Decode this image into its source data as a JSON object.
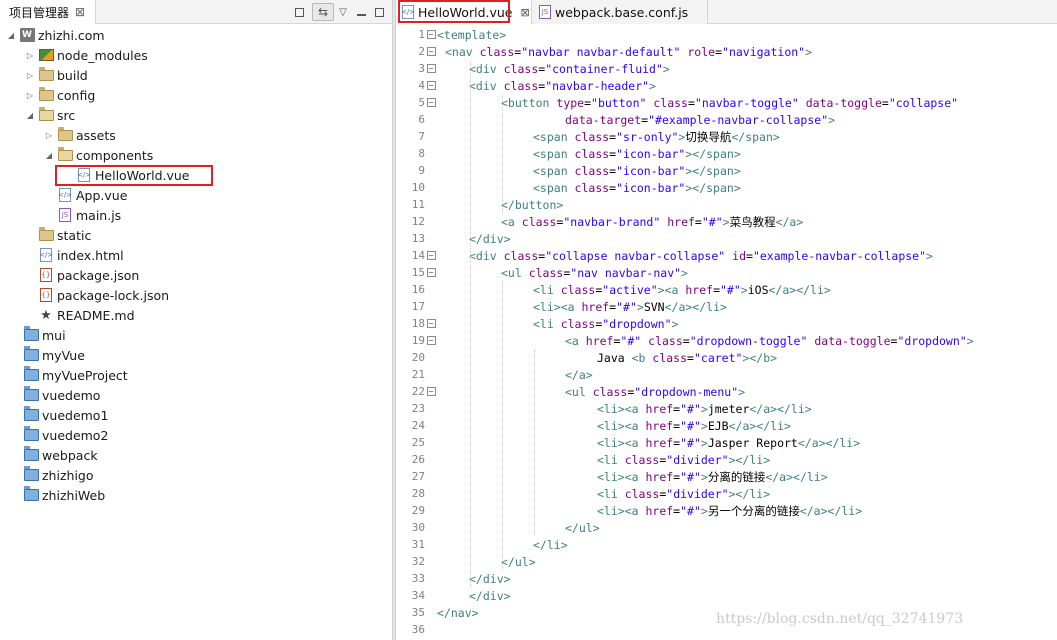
{
  "left_panel": {
    "tab_title": "项目管理器",
    "tab_close": "⊠",
    "toolbar": {
      "link_icon": "⇆",
      "menu_icon": "▽"
    },
    "tree": [
      {
        "label": "zhizhi.com",
        "icon": "web-project-icon",
        "toggle": "◢"
      },
      {
        "label": "node_modules",
        "icon": "node-modules-icon",
        "toggle": "▷"
      },
      {
        "label": "build",
        "icon": "folder-icon",
        "toggle": "▷"
      },
      {
        "label": "config",
        "icon": "folder-icon",
        "toggle": "▷"
      },
      {
        "label": "src",
        "icon": "folder-open-icon",
        "toggle": "◢"
      },
      {
        "label": "assets",
        "icon": "folder-icon",
        "toggle": "▷"
      },
      {
        "label": "components",
        "icon": "folder-open-icon",
        "toggle": "◢"
      },
      {
        "label": "HelloWorld.vue",
        "icon": "vue-file-icon",
        "toggle": ""
      },
      {
        "label": "App.vue",
        "icon": "vue-file-icon",
        "toggle": ""
      },
      {
        "label": "main.js",
        "icon": "js-file-icon",
        "toggle": ""
      },
      {
        "label": "static",
        "icon": "folder-icon",
        "toggle": ""
      },
      {
        "label": "index.html",
        "icon": "html-file-icon",
        "toggle": ""
      },
      {
        "label": "package.json",
        "icon": "json-file-icon",
        "toggle": ""
      },
      {
        "label": "package-lock.json",
        "icon": "json-file-icon",
        "toggle": ""
      },
      {
        "label": "README.md",
        "icon": "star-icon",
        "toggle": ""
      },
      {
        "label": "mui",
        "icon": "project-icon",
        "toggle": ""
      },
      {
        "label": "myVue",
        "icon": "project-icon",
        "toggle": ""
      },
      {
        "label": "myVueProject",
        "icon": "project-icon",
        "toggle": ""
      },
      {
        "label": "vuedemo",
        "icon": "project-icon",
        "toggle": ""
      },
      {
        "label": "vuedemo1",
        "icon": "project-icon",
        "toggle": ""
      },
      {
        "label": "vuedemo2",
        "icon": "project-icon",
        "toggle": ""
      },
      {
        "label": "webpack",
        "icon": "project-icon",
        "toggle": ""
      },
      {
        "label": "zhizhigo",
        "icon": "project-icon",
        "toggle": ""
      },
      {
        "label": "zhizhiWeb",
        "icon": "project-icon",
        "toggle": ""
      }
    ]
  },
  "editor": {
    "tabs": [
      {
        "label": "HelloWorld.vue",
        "close": "⊠"
      },
      {
        "label": "webpack.base.conf.js"
      }
    ],
    "watermark": "https://blog.csdn.net/qq_32741973",
    "lines": [
      {
        "n": "1",
        "fold": "−",
        "indent": 0,
        "parts": [
          [
            "tag",
            "<template>"
          ]
        ]
      },
      {
        "n": "2",
        "fold": "−",
        "indent": 1,
        "parts": [
          [
            "tag",
            "<nav "
          ],
          [
            "attr",
            "class"
          ],
          [
            "txt",
            "="
          ],
          [
            "val",
            "\"navbar navbar-default\""
          ],
          [
            "txt",
            " "
          ],
          [
            "attr",
            "role"
          ],
          [
            "txt",
            "="
          ],
          [
            "val",
            "\"navigation\""
          ],
          [
            "tag",
            ">"
          ]
        ]
      },
      {
        "n": "3",
        "fold": "−",
        "indent": 2,
        "parts": [
          [
            "tag",
            "<div "
          ],
          [
            "attr",
            "class"
          ],
          [
            "txt",
            "="
          ],
          [
            "val",
            "\"container-fluid\""
          ],
          [
            "tag",
            ">"
          ]
        ]
      },
      {
        "n": "4",
        "fold": "−",
        "indent": 2,
        "parts": [
          [
            "tag",
            "<div "
          ],
          [
            "attr",
            "class"
          ],
          [
            "txt",
            "="
          ],
          [
            "val",
            "\"navbar-header\""
          ],
          [
            "tag",
            ">"
          ]
        ]
      },
      {
        "n": "5",
        "fold": "−",
        "indent": 3,
        "parts": [
          [
            "tag",
            "<button "
          ],
          [
            "attr",
            "type"
          ],
          [
            "txt",
            "="
          ],
          [
            "val",
            "\"button\""
          ],
          [
            "txt",
            " "
          ],
          [
            "attr",
            "class"
          ],
          [
            "txt",
            "="
          ],
          [
            "val",
            "\"navbar-toggle\""
          ],
          [
            "txt",
            " "
          ],
          [
            "attr",
            "data-toggle"
          ],
          [
            "txt",
            "="
          ],
          [
            "val",
            "\"collapse\""
          ]
        ]
      },
      {
        "n": "6",
        "fold": "",
        "indent": 5,
        "parts": [
          [
            "attr",
            "data-target"
          ],
          [
            "txt",
            "="
          ],
          [
            "val",
            "\"#example-navbar-collapse\""
          ],
          [
            "tag",
            ">"
          ]
        ]
      },
      {
        "n": "7",
        "fold": "",
        "indent": 4,
        "parts": [
          [
            "tag",
            "<span "
          ],
          [
            "attr",
            "class"
          ],
          [
            "txt",
            "="
          ],
          [
            "val",
            "\"sr-only\""
          ],
          [
            "tag",
            ">"
          ],
          [
            "txt",
            "切换导航"
          ],
          [
            "tag",
            "</span>"
          ]
        ]
      },
      {
        "n": "8",
        "fold": "",
        "indent": 4,
        "parts": [
          [
            "tag",
            "<span "
          ],
          [
            "attr",
            "class"
          ],
          [
            "txt",
            "="
          ],
          [
            "val",
            "\"icon-bar\""
          ],
          [
            "tag",
            "></span>"
          ]
        ]
      },
      {
        "n": "9",
        "fold": "",
        "indent": 4,
        "parts": [
          [
            "tag",
            "<span "
          ],
          [
            "attr",
            "class"
          ],
          [
            "txt",
            "="
          ],
          [
            "val",
            "\"icon-bar\""
          ],
          [
            "tag",
            "></span>"
          ]
        ]
      },
      {
        "n": "10",
        "fold": "",
        "indent": 4,
        "parts": [
          [
            "tag",
            "<span "
          ],
          [
            "attr",
            "class"
          ],
          [
            "txt",
            "="
          ],
          [
            "val",
            "\"icon-bar\""
          ],
          [
            "tag",
            "></span>"
          ]
        ]
      },
      {
        "n": "11",
        "fold": "",
        "indent": 3,
        "parts": [
          [
            "tag",
            "</button>"
          ]
        ]
      },
      {
        "n": "12",
        "fold": "",
        "indent": 3,
        "parts": [
          [
            "tag",
            "<a "
          ],
          [
            "attr",
            "class"
          ],
          [
            "txt",
            "="
          ],
          [
            "val",
            "\"navbar-brand\""
          ],
          [
            "txt",
            " "
          ],
          [
            "attr",
            "href"
          ],
          [
            "txt",
            "="
          ],
          [
            "val",
            "\"#\""
          ],
          [
            "tag",
            ">"
          ],
          [
            "txt",
            "菜鸟教程"
          ],
          [
            "tag",
            "</a>"
          ]
        ]
      },
      {
        "n": "13",
        "fold": "",
        "indent": 2,
        "parts": [
          [
            "tag",
            "</div>"
          ]
        ]
      },
      {
        "n": "14",
        "fold": "−",
        "indent": 2,
        "parts": [
          [
            "tag",
            "<div "
          ],
          [
            "attr",
            "class"
          ],
          [
            "txt",
            "="
          ],
          [
            "val",
            "\"collapse navbar-collapse\""
          ],
          [
            "txt",
            " "
          ],
          [
            "attr",
            "id"
          ],
          [
            "txt",
            "="
          ],
          [
            "val",
            "\"example-navbar-collapse\""
          ],
          [
            "tag",
            ">"
          ]
        ]
      },
      {
        "n": "15",
        "fold": "−",
        "indent": 3,
        "parts": [
          [
            "tag",
            "<ul "
          ],
          [
            "attr",
            "class"
          ],
          [
            "txt",
            "="
          ],
          [
            "val",
            "\"nav navbar-nav\""
          ],
          [
            "tag",
            ">"
          ]
        ]
      },
      {
        "n": "16",
        "fold": "",
        "indent": 4,
        "parts": [
          [
            "tag",
            "<li "
          ],
          [
            "attr",
            "class"
          ],
          [
            "txt",
            "="
          ],
          [
            "val",
            "\"active\""
          ],
          [
            "tag",
            "><a "
          ],
          [
            "attr",
            "href"
          ],
          [
            "txt",
            "="
          ],
          [
            "val",
            "\"#\""
          ],
          [
            "tag",
            ">"
          ],
          [
            "txt",
            "iOS"
          ],
          [
            "tag",
            "</a></li>"
          ]
        ]
      },
      {
        "n": "17",
        "fold": "",
        "indent": 4,
        "parts": [
          [
            "tag",
            "<li><a "
          ],
          [
            "attr",
            "href"
          ],
          [
            "txt",
            "="
          ],
          [
            "val",
            "\"#\""
          ],
          [
            "tag",
            ">"
          ],
          [
            "txt",
            "SVN"
          ],
          [
            "tag",
            "</a></li>"
          ]
        ]
      },
      {
        "n": "18",
        "fold": "−",
        "indent": 4,
        "parts": [
          [
            "tag",
            "<li "
          ],
          [
            "attr",
            "class"
          ],
          [
            "txt",
            "="
          ],
          [
            "val",
            "\"dropdown\""
          ],
          [
            "tag",
            ">"
          ]
        ]
      },
      {
        "n": "19",
        "fold": "−",
        "indent": 5,
        "parts": [
          [
            "tag",
            "<a "
          ],
          [
            "attr",
            "href"
          ],
          [
            "txt",
            "="
          ],
          [
            "val",
            "\"#\""
          ],
          [
            "txt",
            " "
          ],
          [
            "attr",
            "class"
          ],
          [
            "txt",
            "="
          ],
          [
            "val",
            "\"dropdown-toggle\""
          ],
          [
            "txt",
            " "
          ],
          [
            "attr",
            "data-toggle"
          ],
          [
            "txt",
            "="
          ],
          [
            "val",
            "\"dropdown\""
          ],
          [
            "tag",
            ">"
          ]
        ]
      },
      {
        "n": "20",
        "fold": "",
        "indent": 6,
        "parts": [
          [
            "txt",
            "Java "
          ],
          [
            "tag",
            "<b "
          ],
          [
            "attr",
            "class"
          ],
          [
            "txt",
            "="
          ],
          [
            "val",
            "\"caret\""
          ],
          [
            "tag",
            "></b>"
          ]
        ]
      },
      {
        "n": "21",
        "fold": "",
        "indent": 5,
        "parts": [
          [
            "tag",
            "</a>"
          ]
        ]
      },
      {
        "n": "22",
        "fold": "−",
        "indent": 5,
        "parts": [
          [
            "tag",
            "<ul "
          ],
          [
            "attr",
            "class"
          ],
          [
            "txt",
            "="
          ],
          [
            "val",
            "\"dropdown-menu\""
          ],
          [
            "tag",
            ">"
          ]
        ]
      },
      {
        "n": "23",
        "fold": "",
        "indent": 6,
        "parts": [
          [
            "tag",
            "<li><a "
          ],
          [
            "attr",
            "href"
          ],
          [
            "txt",
            "="
          ],
          [
            "val",
            "\"#\""
          ],
          [
            "tag",
            ">"
          ],
          [
            "txt",
            "jmeter"
          ],
          [
            "tag",
            "</a></li>"
          ]
        ]
      },
      {
        "n": "24",
        "fold": "",
        "indent": 6,
        "parts": [
          [
            "tag",
            "<li><a "
          ],
          [
            "attr",
            "href"
          ],
          [
            "txt",
            "="
          ],
          [
            "val",
            "\"#\""
          ],
          [
            "tag",
            ">"
          ],
          [
            "txt",
            "EJB"
          ],
          [
            "tag",
            "</a></li>"
          ]
        ]
      },
      {
        "n": "25",
        "fold": "",
        "indent": 6,
        "parts": [
          [
            "tag",
            "<li><a "
          ],
          [
            "attr",
            "href"
          ],
          [
            "txt",
            "="
          ],
          [
            "val",
            "\"#\""
          ],
          [
            "tag",
            ">"
          ],
          [
            "txt",
            "Jasper Report"
          ],
          [
            "tag",
            "</a></li>"
          ]
        ]
      },
      {
        "n": "26",
        "fold": "",
        "indent": 6,
        "parts": [
          [
            "tag",
            "<li "
          ],
          [
            "attr",
            "class"
          ],
          [
            "txt",
            "="
          ],
          [
            "val",
            "\"divider\""
          ],
          [
            "tag",
            "></li>"
          ]
        ]
      },
      {
        "n": "27",
        "fold": "",
        "indent": 6,
        "parts": [
          [
            "tag",
            "<li><a "
          ],
          [
            "attr",
            "href"
          ],
          [
            "txt",
            "="
          ],
          [
            "val",
            "\"#\""
          ],
          [
            "tag",
            ">"
          ],
          [
            "txt",
            "分离的链接"
          ],
          [
            "tag",
            "</a></li>"
          ]
        ]
      },
      {
        "n": "28",
        "fold": "",
        "indent": 6,
        "parts": [
          [
            "tag",
            "<li "
          ],
          [
            "attr",
            "class"
          ],
          [
            "txt",
            "="
          ],
          [
            "val",
            "\"divider\""
          ],
          [
            "tag",
            "></li>"
          ]
        ]
      },
      {
        "n": "29",
        "fold": "",
        "indent": 6,
        "parts": [
          [
            "tag",
            "<li><a "
          ],
          [
            "attr",
            "href"
          ],
          [
            "txt",
            "="
          ],
          [
            "val",
            "\"#\""
          ],
          [
            "tag",
            ">"
          ],
          [
            "txt",
            "另一个分离的链接"
          ],
          [
            "tag",
            "</a></li>"
          ]
        ]
      },
      {
        "n": "30",
        "fold": "",
        "indent": 5,
        "parts": [
          [
            "tag",
            "</ul>"
          ]
        ]
      },
      {
        "n": "31",
        "fold": "",
        "indent": 4,
        "parts": [
          [
            "tag",
            "</li>"
          ]
        ]
      },
      {
        "n": "32",
        "fold": "",
        "indent": 3,
        "parts": [
          [
            "tag",
            "</ul>"
          ]
        ]
      },
      {
        "n": "33",
        "fold": "",
        "indent": 2,
        "parts": [
          [
            "tag",
            "</div>"
          ]
        ]
      },
      {
        "n": "34",
        "fold": "",
        "indent": 2,
        "parts": [
          [
            "tag",
            "</div>"
          ]
        ]
      },
      {
        "n": "35",
        "fold": "",
        "indent": 0,
        "parts": [
          [
            "tag",
            "</nav>"
          ]
        ]
      },
      {
        "n": "36",
        "fold": "",
        "indent": 0,
        "parts": []
      }
    ]
  }
}
